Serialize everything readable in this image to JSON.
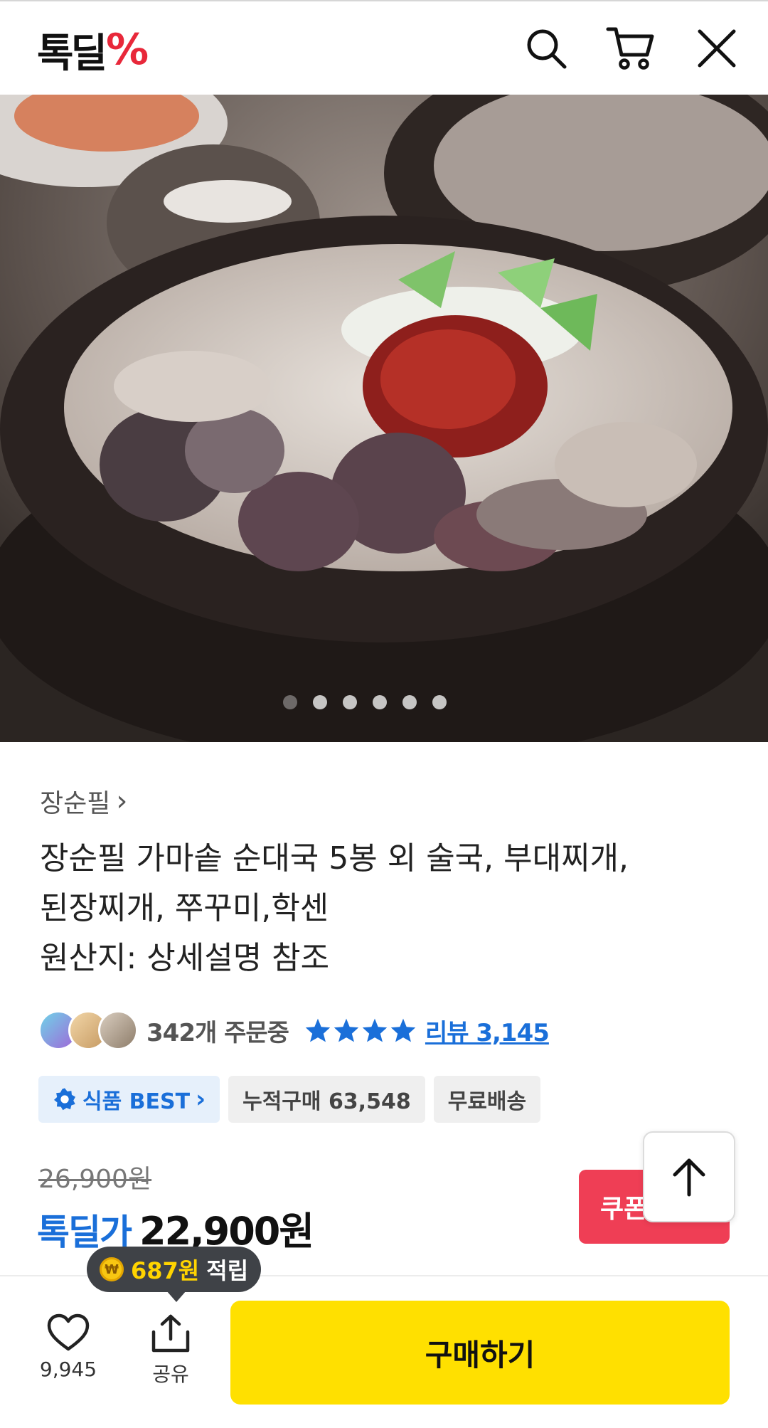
{
  "header": {
    "logo_text": "톡딜",
    "logo_mark": "%",
    "icons": [
      "search-icon",
      "cart-icon",
      "close-icon"
    ]
  },
  "hero": {
    "slide_count": 6,
    "active_slide": 1
  },
  "product": {
    "brand": "장순필",
    "brand_chevron": "›",
    "title_lines": [
      "장순필 가마솥 순대국 5봉 외 술국, 부대찌개,",
      "된장찌개, 쭈꾸미,학센",
      "원산지: 상세설명 참조"
    ]
  },
  "social": {
    "orders": "342개 주문중",
    "rating": 4,
    "review": "리뷰 3,145"
  },
  "badges": {
    "best": "식품 BEST",
    "cumulative": "누적구매 63,548",
    "shipping": "무료배송"
  },
  "price": {
    "original": "26,900원",
    "label": "톡딜가",
    "sale": "22,900원"
  },
  "coupon": {
    "label": "쿠폰"
  },
  "points": {
    "coin": "₩",
    "amount": "687원",
    "label": "적립"
  },
  "bottom": {
    "likes": "9,945",
    "share": "공유",
    "buy": "구매하기"
  },
  "colors": {
    "accent_blue": "#1a6fd9",
    "brand_red": "#e8283a",
    "buy_yellow": "#ffe000",
    "coupon_red": "#ef3e55"
  }
}
